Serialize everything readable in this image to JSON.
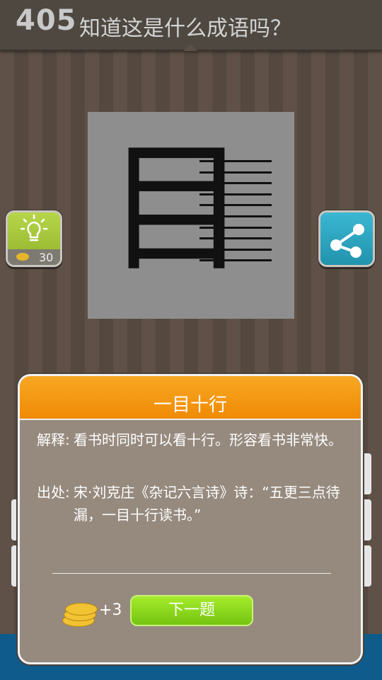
{
  "header": {
    "level": "405",
    "question": "知道这是什么成语吗？"
  },
  "puzzle": {
    "character": "目"
  },
  "hint_button": {
    "icon": "lightbulb-icon",
    "cost": "30",
    "color": "#a5c73b"
  },
  "share_button": {
    "icon": "share-icon",
    "color": "#2ea8c3"
  },
  "dialog": {
    "title": "一目十行",
    "explanation_label": "解释:",
    "explanation_text": "看书时同时可以看十行。形容看书非常快。",
    "source_label": "出处:",
    "source_text": "宋·刘克庄《杂记六言诗》诗：“五更三点待漏，一目十行读书。”",
    "reward": "+3",
    "next_button": "下一题",
    "accent": "#f39a12"
  }
}
